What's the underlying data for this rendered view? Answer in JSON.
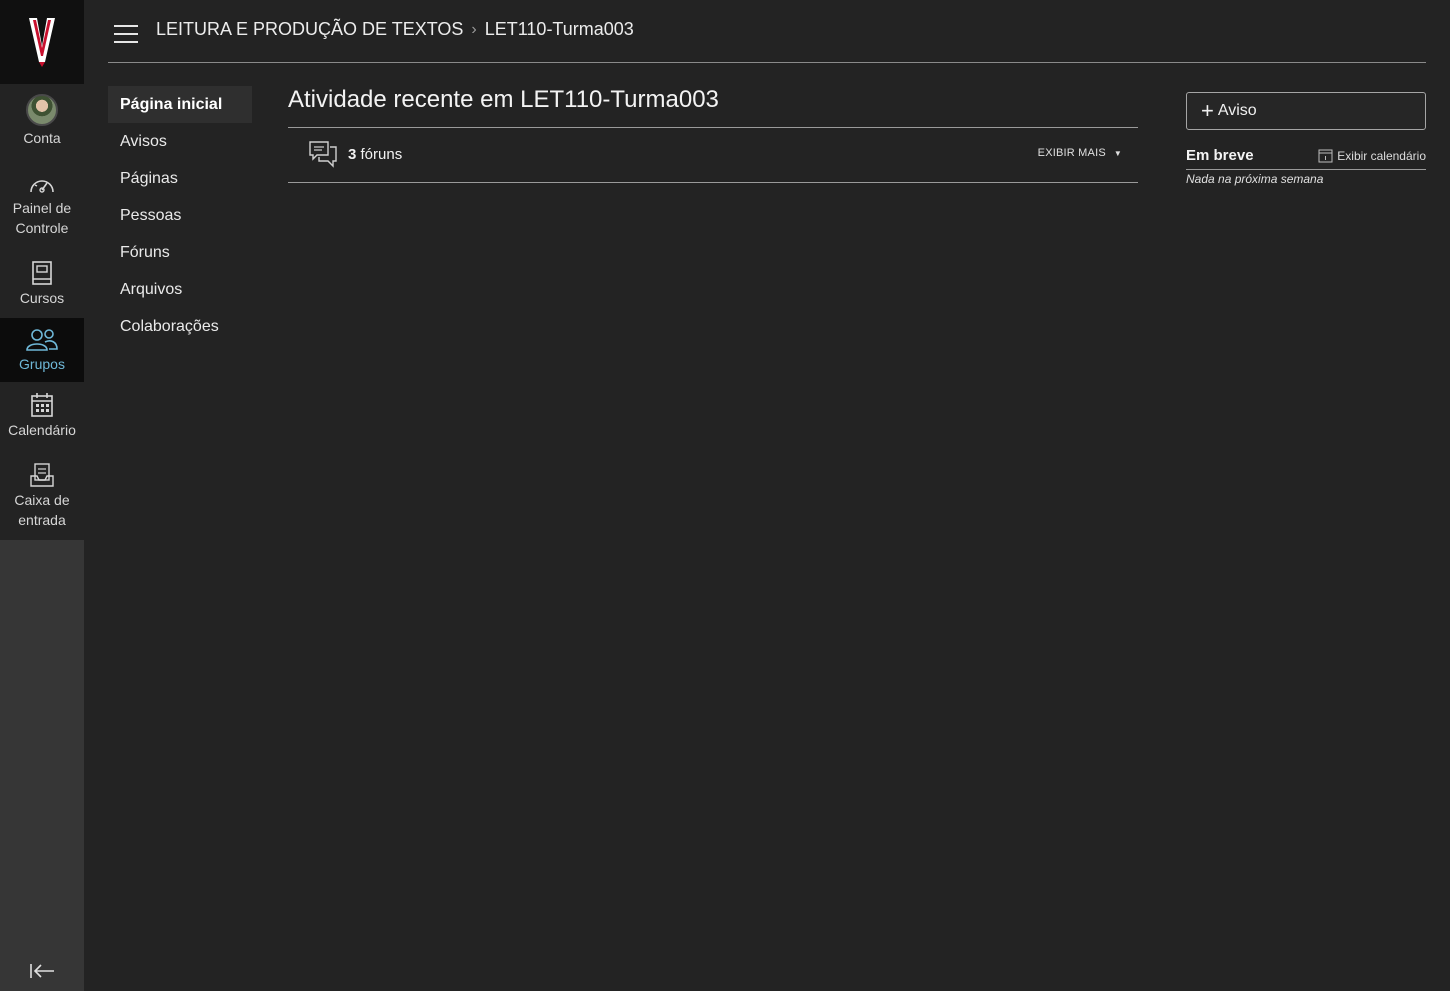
{
  "global_nav": {
    "logo_letter": "V",
    "items": [
      {
        "label": "Conta",
        "icon": "avatar"
      },
      {
        "label": "Painel de Controle",
        "icon": "dashboard-icon"
      },
      {
        "label": "Cursos",
        "icon": "courses-icon"
      },
      {
        "label": "Grupos",
        "icon": "groups-icon",
        "active": true
      },
      {
        "label": "Calendário",
        "icon": "calendar-icon"
      },
      {
        "label": "Caixa de entrada",
        "icon": "inbox-icon"
      }
    ],
    "collapse_icon": "collapse-nav-icon"
  },
  "header": {
    "breadcrumb": [
      "LEITURA E PRODUÇÃO DE TEXTOS",
      "LET110-Turma003"
    ]
  },
  "course_nav": {
    "items": [
      "Página inicial",
      "Avisos",
      "Páginas",
      "Pessoas",
      "Fóruns",
      "Arquivos",
      "Colaborações"
    ],
    "active_index": 0
  },
  "main": {
    "title": "Atividade recente em LET110-Turma003",
    "activity": {
      "count": "3",
      "label": "fóruns",
      "show_more": "EXIBIR MAIS"
    }
  },
  "aside": {
    "new_button": "Aviso",
    "coming_up_title": "Em breve",
    "calendar_link": "Exibir calendário",
    "empty_text": "Nada na próxima semana"
  },
  "colors": {
    "background": "#232323",
    "nav_background": "#363636",
    "active_accent": "#6fb8d8",
    "logo_red": "#c8102e"
  }
}
